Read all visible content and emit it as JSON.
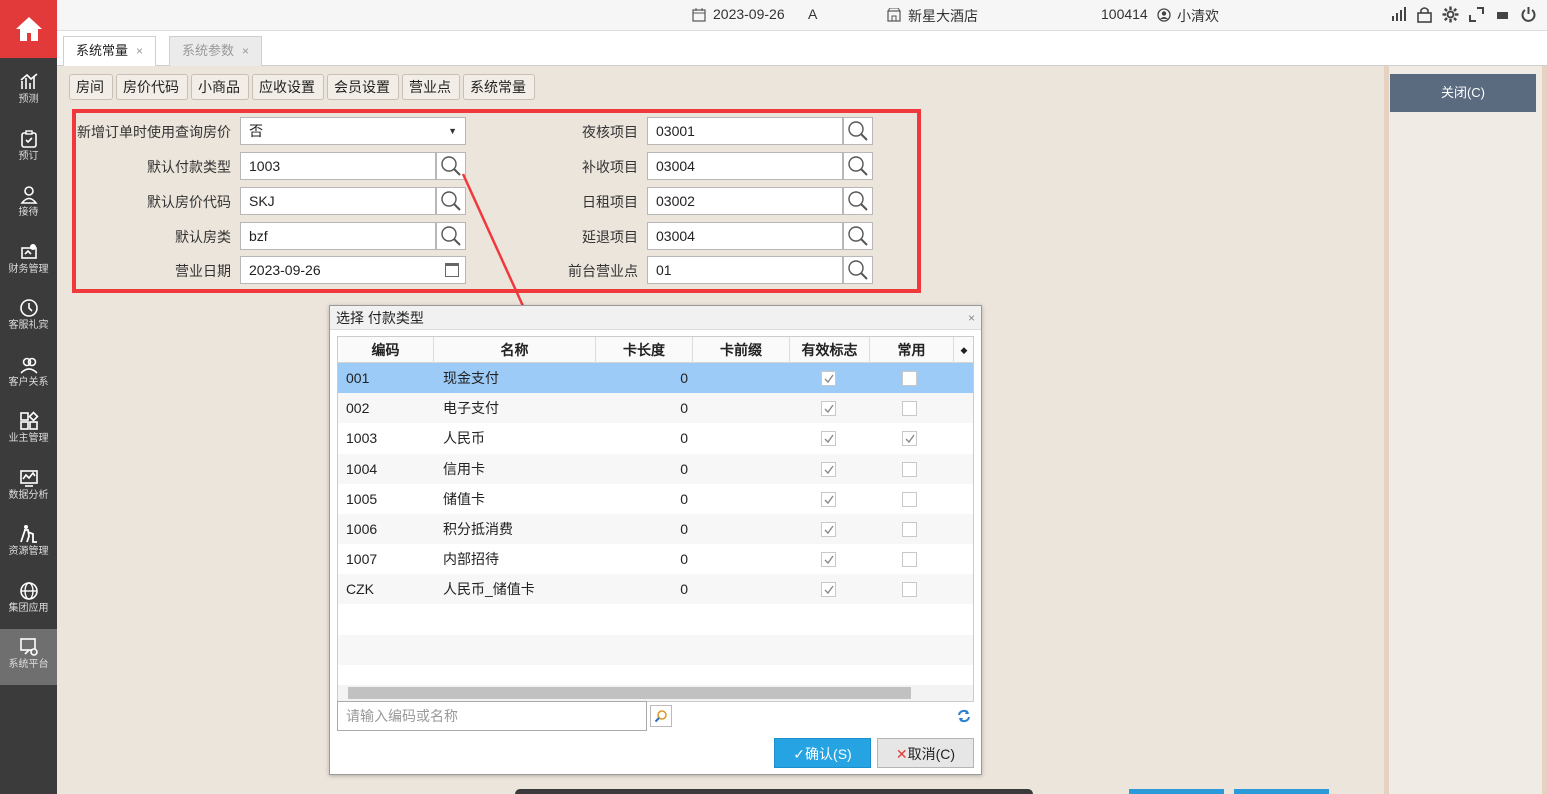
{
  "topbar": {
    "date": "2023-09-26",
    "shift": "A",
    "hotel": "新星大酒店",
    "user_id": "100414",
    "user_name": "小清欢"
  },
  "tabs": [
    {
      "label": "系统常量",
      "close": "×"
    },
    {
      "label": "系统参数",
      "close": "×"
    }
  ],
  "sidebar": {
    "items": [
      {
        "label": "预测"
      },
      {
        "label": "预订"
      },
      {
        "label": "接待"
      },
      {
        "label": "财务管理"
      },
      {
        "label": "客服礼宾"
      },
      {
        "label": "客户关系"
      },
      {
        "label": "业主管理"
      },
      {
        "label": "数据分析"
      },
      {
        "label": "资源管理"
      },
      {
        "label": "集团应用"
      },
      {
        "label": "系统平台"
      }
    ]
  },
  "breadcrumb": [
    "房间",
    "房价代码",
    "小商品",
    "应收设置",
    "会员设置",
    "营业点",
    "系统常量"
  ],
  "form": {
    "left": [
      {
        "label": "新增订单时使用查询房价",
        "value": "否"
      },
      {
        "label": "默认付款类型",
        "value": "1003"
      },
      {
        "label": "默认房价代码",
        "value": "SKJ"
      },
      {
        "label": "默认房类",
        "value": "bzf"
      },
      {
        "label": "营业日期",
        "value": "2023-09-26"
      }
    ],
    "right": [
      {
        "label": "夜核项目",
        "value": "03001"
      },
      {
        "label": "补收项目",
        "value": "03004"
      },
      {
        "label": "日租项目",
        "value": "03002"
      },
      {
        "label": "延退项目",
        "value": "03004"
      },
      {
        "label": "前台营业点",
        "value": "01"
      }
    ]
  },
  "right_panel": {
    "close_label": "关闭(C)"
  },
  "dialog": {
    "title": "选择 付款类型",
    "close": "×",
    "columns": [
      "编码",
      "名称",
      "卡长度",
      "卡前缀",
      "有效标志",
      "常用"
    ],
    "rows": [
      {
        "code": "001",
        "name": "现金支付",
        "len": "0",
        "prefix": "",
        "valid": true,
        "common": false
      },
      {
        "code": "002",
        "name": "电子支付",
        "len": "0",
        "prefix": "",
        "valid": true,
        "common": false
      },
      {
        "code": "1003",
        "name": "人民币",
        "len": "0",
        "prefix": "",
        "valid": true,
        "common": true
      },
      {
        "code": "1004",
        "name": "信用卡",
        "len": "0",
        "prefix": "",
        "valid": true,
        "common": false
      },
      {
        "code": "1005",
        "name": "储值卡",
        "len": "0",
        "prefix": "",
        "valid": true,
        "common": false
      },
      {
        "code": "1006",
        "name": "积分抵消费",
        "len": "0",
        "prefix": "",
        "valid": true,
        "common": false
      },
      {
        "code": "1007",
        "name": "内部招待",
        "len": "0",
        "prefix": "",
        "valid": true,
        "common": false
      },
      {
        "code": "CZK",
        "name": "人民币_储值卡",
        "len": "0",
        "prefix": "",
        "valid": true,
        "common": false
      }
    ],
    "search_placeholder": "请输入编码或名称",
    "ok_label": "确认(S)",
    "cancel_label": "取消(C)"
  },
  "colors": {
    "accent_red": "#e23a3a",
    "highlight_red": "#f0393c",
    "selected_row": "#9bcbf6",
    "ok_blue": "#25a3e3",
    "sidebar_bg": "#3b3b3b"
  }
}
